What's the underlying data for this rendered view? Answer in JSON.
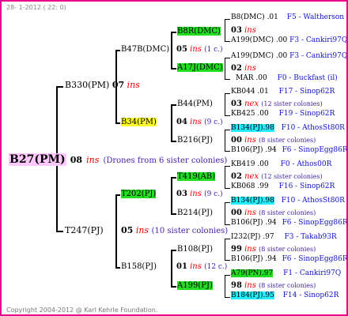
{
  "header": "28- 1-2012 ( 22: 0)",
  "footer": "Copyright 2004-2012 @ Karl Kehrle Foundation.",
  "root": {
    "label": "B27(PM)",
    "count": "08",
    "ins": "ins",
    "note": "(Drones from 6 sister colonies)"
  },
  "sire": {
    "label": "B330(PM)",
    "count": "07",
    "ins": "ins",
    "paternal": {
      "label": "B47B(DMC)",
      "count": "05",
      "ins": "ins",
      "note": "(1 c.)",
      "top": {
        "label": "B8R(DMC)",
        "count": "03",
        "ins": "ins",
        "e1": {
          "label": "B8(DMC)",
          "val": ".01",
          "ref": "F5 - Waltherson"
        },
        "e2": {
          "label": "A199(DMC)",
          "val": ".00",
          "ref": "F3 - Cankiri97Q"
        }
      },
      "bottom": {
        "label": "A17J(DMC)",
        "count": "02",
        "ins": "ins",
        "e1": {
          "label": "A199(DMC)",
          "val": ".00",
          "ref": "F3 - Cankiri97Q"
        },
        "e2": {
          "label": "MAR",
          "val": ".00",
          "ref": "F0 - Buckfast (il)"
        }
      }
    },
    "maternal": {
      "label": "B34(PM)",
      "count": "04",
      "ins": "ins",
      "note": "(9 c.)",
      "top": {
        "label": "B44(PM)",
        "count": "03",
        "ins": "nex",
        "note": "(12 sister colonies)",
        "e1": {
          "label": "KB044",
          "val": ".01",
          "ref": "F17 - Sinop62R"
        },
        "e2": {
          "label": "KB425",
          "val": ".00",
          "ref": "F19 - Sinop62R"
        }
      },
      "bottom": {
        "label": "B216(PJ)",
        "count": "00",
        "ins": "ins",
        "note": "(8 sister colonies)",
        "e1": {
          "label": "B134(PJ)",
          "val": ".98",
          "ref": "F10 - AthosSt80R"
        },
        "e2": {
          "label": "B106(PJ)",
          "val": ".94",
          "ref": "F6 - SinopEgg86R"
        }
      }
    }
  },
  "dam": {
    "label": "T247(PJ)",
    "count": "05",
    "ins": "ins",
    "note": "(10 sister colonies)",
    "paternal": {
      "label": "T202(PJ)",
      "count": "03",
      "ins": "ins",
      "note": "(9 c.)",
      "top": {
        "label": "T419(AB)",
        "count": "02",
        "ins": "nex",
        "note": "(12 sister colonies)",
        "e1": {
          "label": "KB419",
          "val": ".00",
          "ref": "F0 - Athos00R"
        },
        "e2": {
          "label": "KB068",
          "val": ".99",
          "ref": "F16 - Sinop62R"
        }
      },
      "bottom": {
        "label": "B214(PJ)",
        "count": "00",
        "ins": "ins",
        "note": "(8 sister colonies)",
        "e1": {
          "label": "B134(PJ)",
          "val": ".98",
          "ref": "F10 - AthosSt80R"
        },
        "e2": {
          "label": "B106(PJ)",
          "val": ".94",
          "ref": "F6 - SinopEgg86R"
        }
      }
    },
    "maternal": {
      "label": "B158(PJ)",
      "count": "01",
      "ins": "ins",
      "note": "(12 c.)",
      "top": {
        "label": "B108(PJ)",
        "count": "99",
        "ins": "ins",
        "note": "(8 sister colonies)",
        "e1": {
          "label": "I232(PJ)",
          "val": ".97",
          "ref": "F3 - Takab93R"
        },
        "e2": {
          "label": "B106(PJ)",
          "val": ".94",
          "ref": "F6 - SinopEgg86R"
        }
      },
      "bottom": {
        "label": "A199(PJ)",
        "count": "98",
        "ins": "ins",
        "note": "(8 sister colonies)",
        "e1": {
          "label": "A79(PN)",
          "val": ".97",
          "ref": "F1 - Cankiri97Q"
        },
        "e2": {
          "label": "B184(PJ)",
          "val": ".95",
          "ref": "F14 - Sinop62R"
        }
      }
    }
  },
  "colors": {
    "border": "#e8008a",
    "root_bg": "#ffc8ff",
    "green": "#22dd22",
    "yellow": "#ffff22",
    "cyan": "#22eeff",
    "ins": "#ee0000",
    "note": "#4422aa",
    "ref": "#1111cc"
  }
}
